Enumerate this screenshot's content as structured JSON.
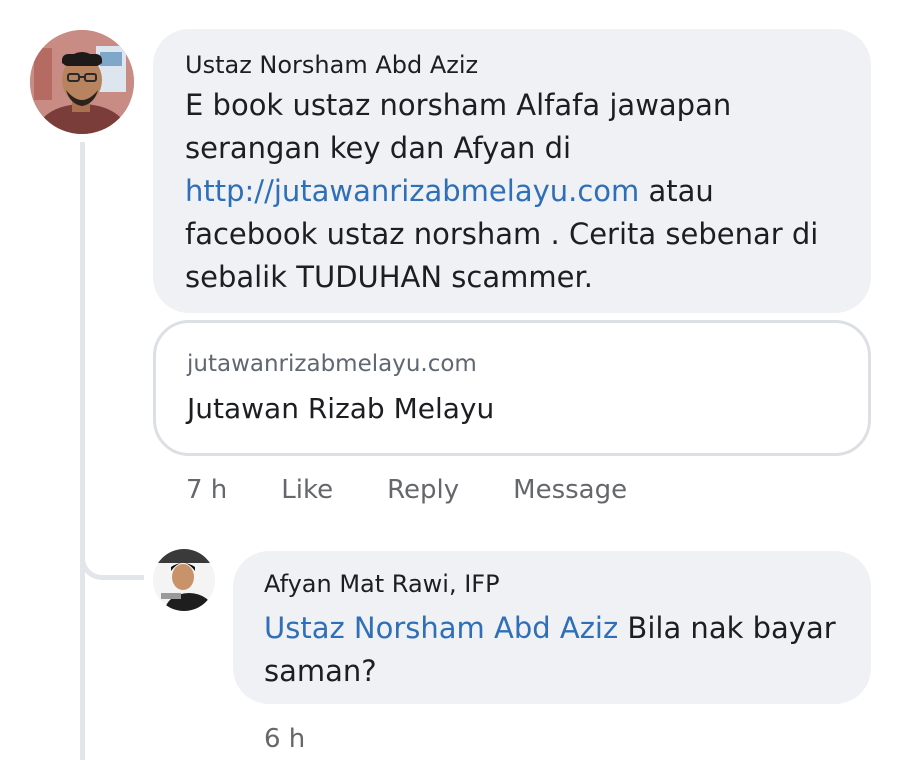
{
  "comments": [
    {
      "author": "Ustaz Norsham Abd Aziz",
      "text_1": "E book ustaz norsham Alfafa jawapan serangan key dan Afyan di ",
      "link": "http://jutawanrizabmelayu.com",
      "text_2": " atau facebook ustaz norsham . Cerita sebenar di sebalik TUDUHAN scammer.",
      "preview": {
        "domain": "jutawanrizabmelayu.com",
        "title": "Jutawan Rizab Melayu"
      },
      "time": "7 h",
      "actions": {
        "like": "Like",
        "reply": "Reply",
        "message": "Message"
      }
    },
    {
      "author": "Afyan Mat Rawi, IFP",
      "mention": "Ustaz Norsham Abd Aziz",
      "text": " Bila nak bayar saman?",
      "time": "6 h"
    }
  ],
  "colors": {
    "bubble": "#eff1f4",
    "link": "#2f6fb7",
    "meta_text": "#65676b",
    "thread_line": "#e2e5ea"
  },
  "icons": [
    "avatar-ustaz-norsham",
    "avatar-afyan"
  ]
}
